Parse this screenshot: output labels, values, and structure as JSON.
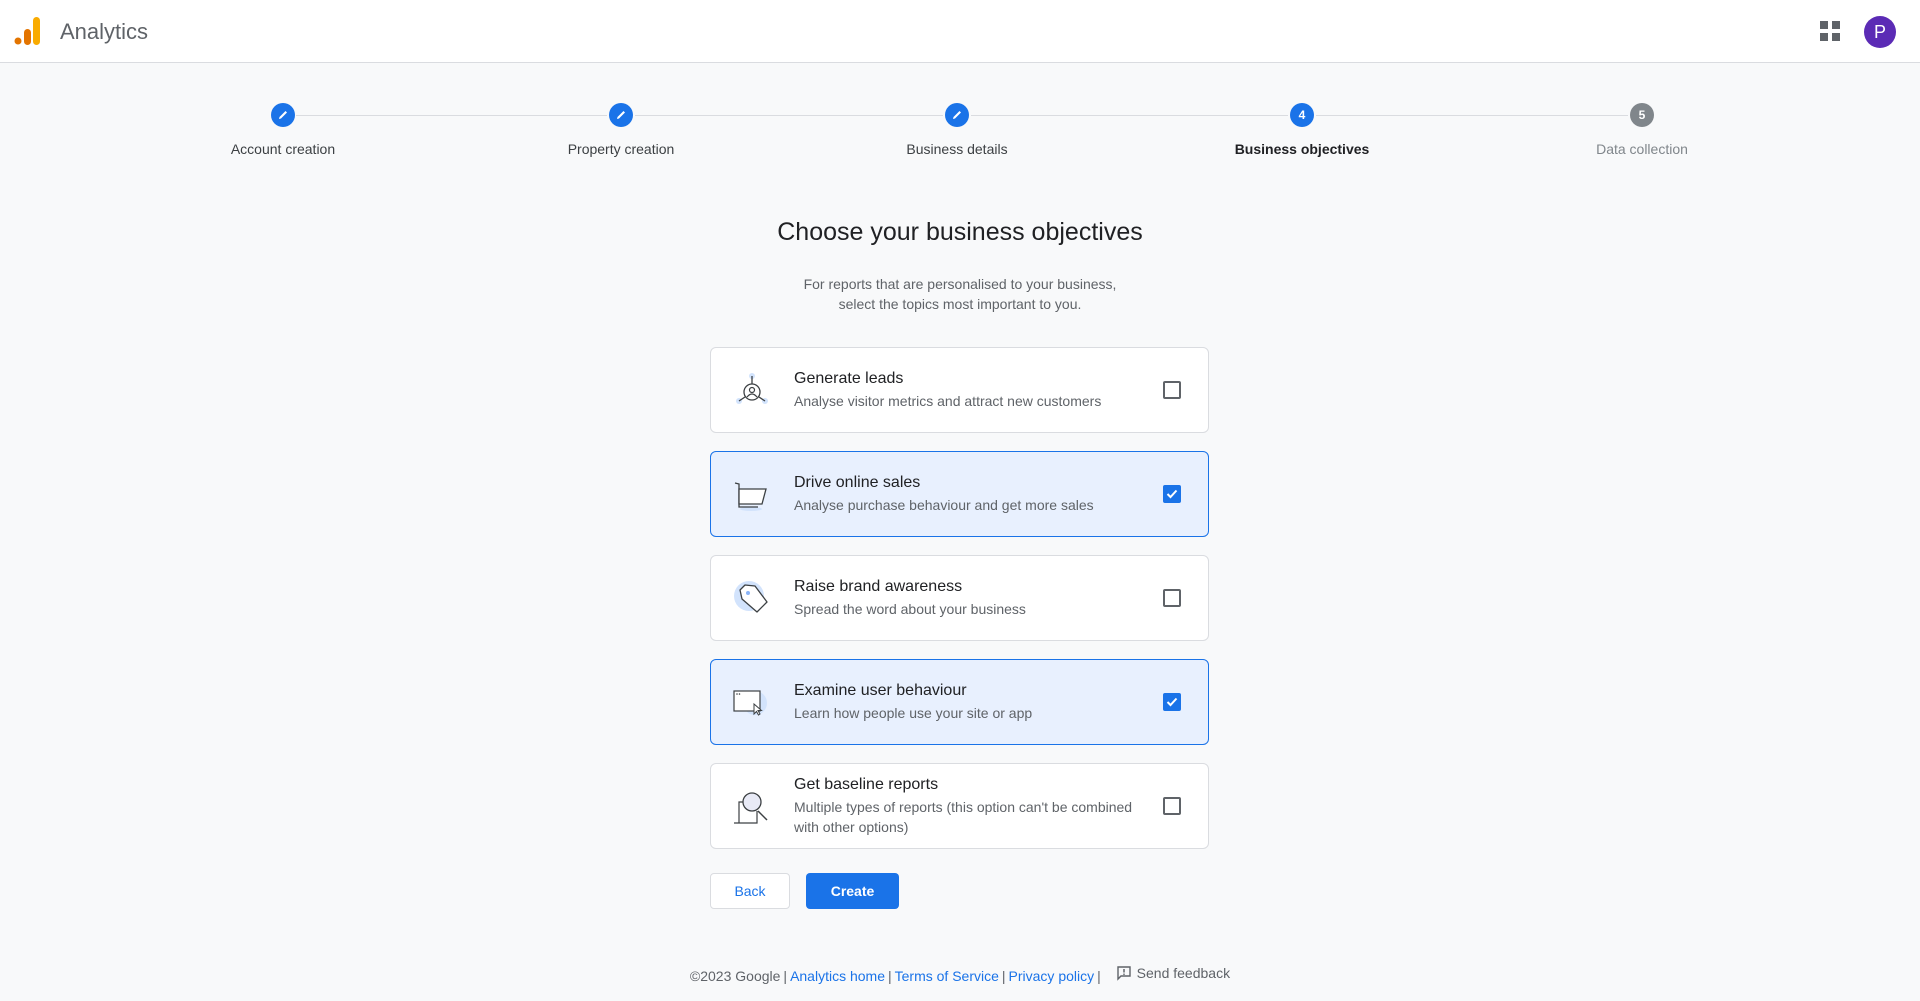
{
  "header": {
    "app_title": "Analytics",
    "logo_icon": "google-analytics-logo",
    "apps_icon": "apps-grid-icon",
    "avatar_initial": "P",
    "avatar_color": "#5b2bb5"
  },
  "stepper": {
    "steps": [
      {
        "label": "Account creation",
        "state": "completed",
        "icon": "edit-pencil-icon"
      },
      {
        "label": "Property creation",
        "state": "completed",
        "icon": "edit-pencil-icon"
      },
      {
        "label": "Business details",
        "state": "completed",
        "icon": "edit-pencil-icon"
      },
      {
        "label": "Business objectives",
        "state": "active",
        "number": "4"
      },
      {
        "label": "Data collection",
        "state": "inactive",
        "number": "5"
      }
    ]
  },
  "main": {
    "title": "Choose your business objectives",
    "subtitle_line1": "For reports that are personalised to your business,",
    "subtitle_line2": "select the topics most important to you.",
    "options": [
      {
        "title": "Generate leads",
        "description": "Analyse visitor metrics and attract new customers",
        "checked": false,
        "icon": "leads-target-icon"
      },
      {
        "title": "Drive online sales",
        "description": "Analyse purchase behaviour and get more sales",
        "checked": true,
        "icon": "shopping-cart-icon"
      },
      {
        "title": "Raise brand awareness",
        "description": "Spread the word about your business",
        "checked": false,
        "icon": "price-tag-icon"
      },
      {
        "title": "Examine user behaviour",
        "description": "Learn how people use your site or app",
        "checked": true,
        "icon": "browser-cursor-icon"
      },
      {
        "title": "Get baseline reports",
        "description": "Multiple types of reports (this option can't be combined with other options)",
        "checked": false,
        "icon": "magnifier-report-icon"
      }
    ],
    "back_label": "Back",
    "create_label": "Create"
  },
  "footer": {
    "copyright": "©2023 Google",
    "links": [
      "Analytics home",
      "Terms of Service",
      "Privacy policy"
    ],
    "feedback_label": "Send feedback"
  },
  "colors": {
    "accent": "#1a73e8",
    "selected_bg": "#e8f0fe",
    "inactive_step": "#80868b"
  }
}
